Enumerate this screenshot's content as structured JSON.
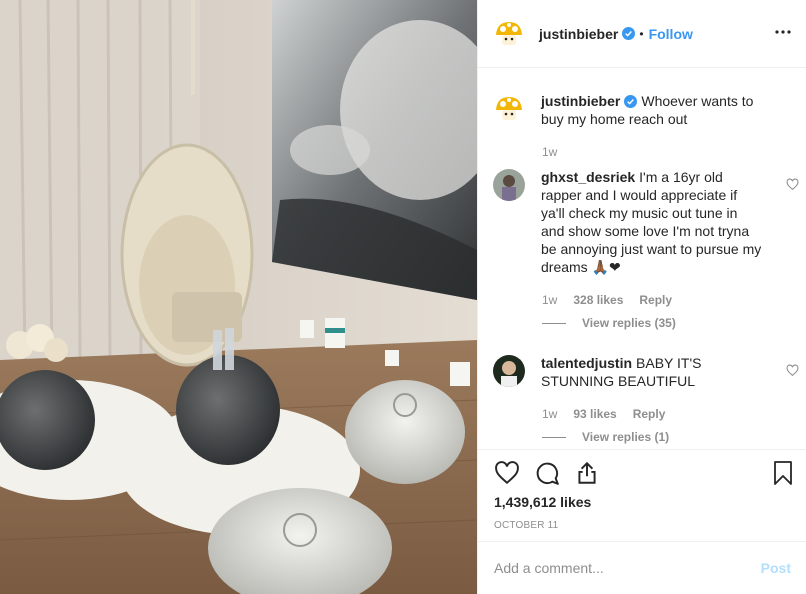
{
  "post": {
    "author": "justinbieber",
    "follow_label": "Follow",
    "dot": "•",
    "caption_text": "Whoever wants to buy my home reach out",
    "caption_time": "1w",
    "likes": "1,439,612 likes",
    "date": "OCTOBER 11"
  },
  "comments": [
    {
      "username": "ghxst_desriek",
      "text": "I'm a 16yr old rapper and I would appreciate if ya'll check my music out tune in and show some love I'm not tryna be annoying just want to pursue my dreams 🙏🏾❤",
      "time": "1w",
      "likes": "328 likes",
      "reply": "Reply",
      "view_replies": "View replies (35)"
    },
    {
      "username": "talentedjustin",
      "text": "BABY IT'S STUNNING BEAUTIFUL",
      "time": "1w",
      "likes": "93 likes",
      "reply": "Reply",
      "view_replies": "View replies (1)"
    }
  ],
  "add_comment": {
    "placeholder": "Add a comment...",
    "post_label": "Post"
  },
  "icons": [
    "mushroom-avatar-icon",
    "verified-badge-icon",
    "more-options-icon",
    "heart-icon",
    "comment-icon",
    "share-icon",
    "bookmark-icon"
  ],
  "colors": {
    "link": "#3897f0",
    "post_disabled": "#b2dffc",
    "muted": "#8e8e8e",
    "text": "#262626"
  }
}
